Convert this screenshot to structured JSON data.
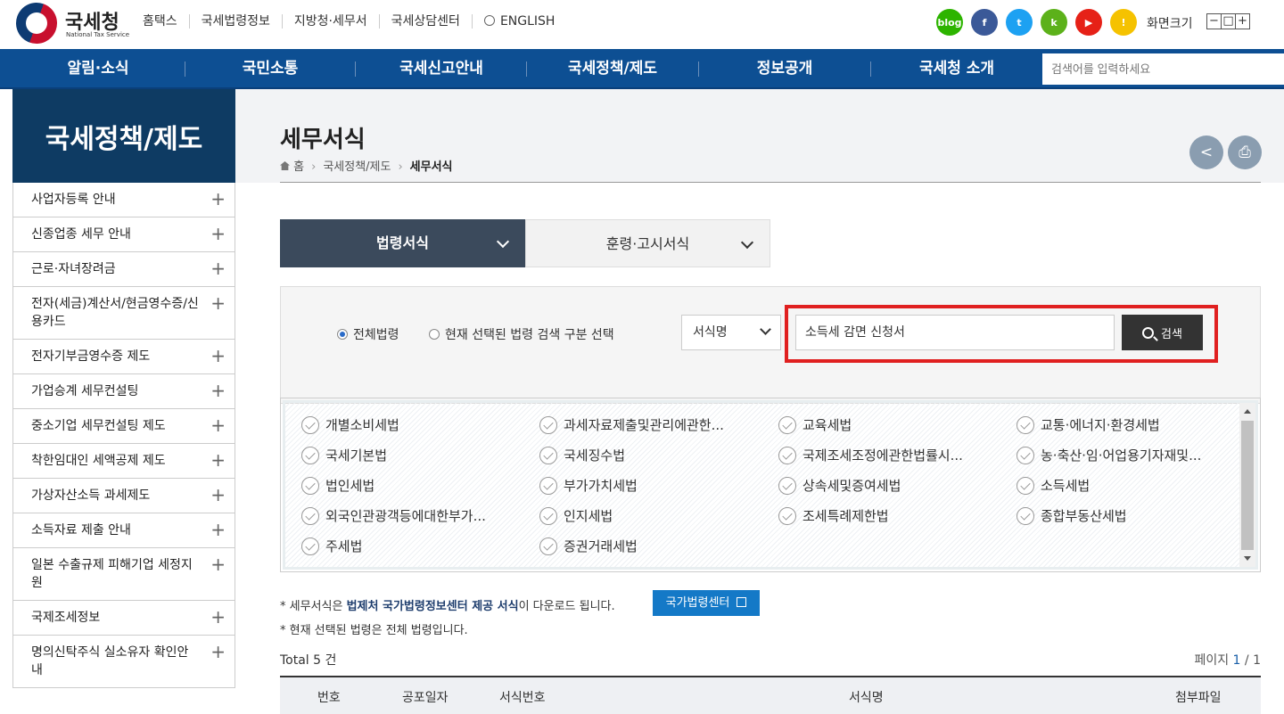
{
  "header": {
    "logo_text": "국세청",
    "logo_sub": "National Tax Service",
    "top_links": [
      "홈택스",
      "국세법령정보",
      "지방청·세무서",
      "국세상담센터",
      "ENGLISH"
    ],
    "sns": [
      {
        "name": "blog-icon",
        "label": "blog",
        "color": "#2db400"
      },
      {
        "name": "facebook-icon",
        "label": "f",
        "color": "#3b5998"
      },
      {
        "name": "twitter-icon",
        "label": "t",
        "color": "#1da1f2"
      },
      {
        "name": "kakaostory-icon",
        "label": "k",
        "color": "#5cb11a"
      },
      {
        "name": "youtube-icon",
        "label": "▶",
        "color": "#e62117"
      },
      {
        "name": "kakaotalk-icon",
        "label": "!",
        "color": "#f5c200"
      }
    ],
    "font_size_label": "화면크기",
    "font_buttons": [
      "−",
      "□",
      "+"
    ]
  },
  "gnb": {
    "items": [
      "알림·소식",
      "국민소통",
      "국세신고안내",
      "국세정책/제도",
      "정보공개",
      "국세청 소개"
    ],
    "search_placeholder": "검색어를 입력하세요"
  },
  "lnb": {
    "title": "국세정책/제도",
    "items": [
      "사업자등록 안내",
      "신종업종 세무 안내",
      "근로·자녀장려금",
      "전자(세금)계산서/현금영수증/신용카드",
      "전자기부금영수증 제도",
      "가업승계 세무컨설팅",
      "중소기업 세무컨설팅 제도",
      "착한임대인 세액공제 제도",
      "가상자산소득 과세제도",
      "소득자료 제출 안내",
      "일본 수출규제 피해기업 세정지원",
      "국제조세정보",
      "명의신탁주식 실소유자 확인안내"
    ]
  },
  "page": {
    "title": "세무서식",
    "breadcrumb": [
      "홈",
      "국세정책/제도",
      "세무서식"
    ]
  },
  "tabs": [
    {
      "label": "법령서식",
      "active": true
    },
    {
      "label": "훈령·고시서식",
      "active": false
    }
  ],
  "search": {
    "radio_all": "전체법령",
    "radio_selected": "현재 선택된 법령 검색 구분 선택",
    "select_value": "서식명",
    "input_value": "소득세 감면 신청서",
    "button_label": "검색"
  },
  "laws": [
    "개별소비세법",
    "과세자료제출및관리에관한...",
    "교육세법",
    "교통·에너지·환경세법",
    "국세기본법",
    "국세징수법",
    "국제조세조정에관한법률시...",
    "농·축산·임·어업용기자재및...",
    "법인세법",
    "부가가치세법",
    "상속세및증여세법",
    "소득세법",
    "외국인관광객등에대한부가...",
    "인지세법",
    "조세특례제한법",
    "종합부동산세법",
    "주세법",
    "증권거래세법"
  ],
  "notes": {
    "note1_prefix": "* 세무서식은 ",
    "note1_bold": "법제처 국가법령정보센터 제공 서식",
    "note1_suffix": "이 다운로드 됩니다.",
    "note1_button": "국가법령센터",
    "note2": "* 현재 선택된 법령은 전체 법령입니다."
  },
  "list": {
    "total_label": "Total",
    "total_count": "5",
    "total_unit": "건",
    "page_label": "페이지",
    "page_current": "1",
    "page_sep": "/",
    "page_total": "1",
    "columns": [
      "번호",
      "공포일자",
      "서식번호",
      "서식명",
      "첨부파일"
    ]
  }
}
